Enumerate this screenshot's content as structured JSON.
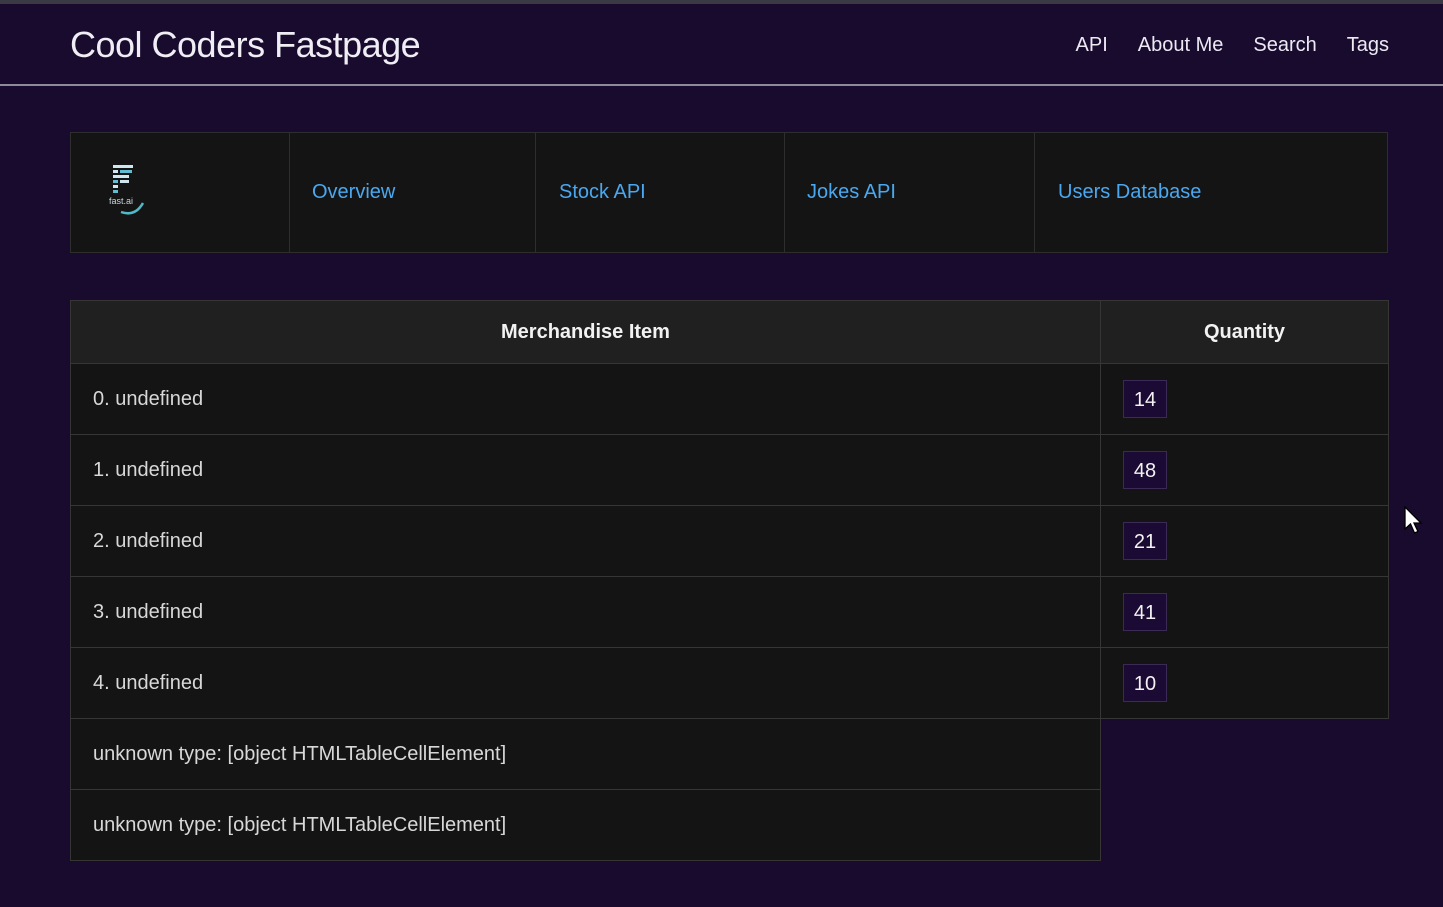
{
  "header": {
    "title": "Cool Coders Fastpage",
    "nav": [
      "API",
      "About Me",
      "Search",
      "Tags"
    ]
  },
  "subnav": {
    "logo_text": "fast.ai",
    "links": [
      "Overview",
      "Stock API",
      "Jokes API",
      "Users Database"
    ]
  },
  "table": {
    "headers": [
      "Merchandise Item",
      "Quantity"
    ],
    "rows": [
      {
        "item": "0. undefined",
        "quantity": "14"
      },
      {
        "item": "1. undefined",
        "quantity": "48"
      },
      {
        "item": "2. undefined",
        "quantity": "21"
      },
      {
        "item": "3. undefined",
        "quantity": "41"
      },
      {
        "item": "4. undefined",
        "quantity": "10"
      }
    ],
    "unknown_rows": [
      "unknown type: [object HTMLTableCellElement]",
      "unknown type: [object HTMLTableCellElement]"
    ]
  },
  "colors": {
    "background": "#190b2e",
    "link": "#4aa8f0",
    "panel": "#141414",
    "badge": "#1b0a33"
  }
}
